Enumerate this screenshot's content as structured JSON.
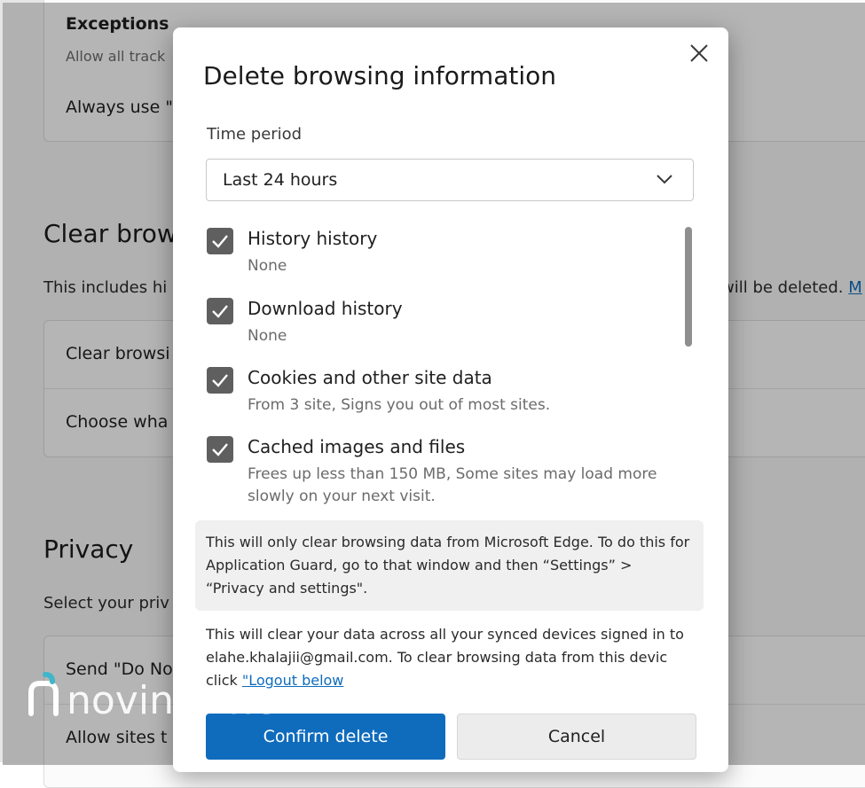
{
  "background": {
    "card1": {
      "exceptions_title": "Exceptions",
      "exceptions_sub": "Allow all track",
      "always_use": "Always use \""
    },
    "clear_section": {
      "title": "Clear brow",
      "desc_left": "This includes hi",
      "desc_right": "will be deleted.",
      "desc_link": "M"
    },
    "card2": {
      "row1": "Clear browsi",
      "row2": "Choose wha"
    },
    "privacy_section": {
      "title": "Privacy",
      "desc": "Select your priv"
    },
    "card3": {
      "row1": "Send \"Do No",
      "row2": "Allow sites t"
    }
  },
  "dialog": {
    "title": "Delete browsing information",
    "time_period_label": "Time period",
    "time_period_value": "Last 24 hours",
    "items": [
      {
        "label": "History history",
        "desc": "None",
        "checked": true
      },
      {
        "label": "Download history",
        "desc": "None",
        "checked": true
      },
      {
        "label": "Cookies and other site data",
        "desc": "From 3 site, Signs you out of most sites.",
        "checked": true
      },
      {
        "label": "Cached images and files",
        "desc": "Frees up less than 150 MB, Some sites may load more slowly on your next visit.",
        "checked": true
      }
    ],
    "note": "This will only clear browsing data from Microsoft Edge. To do this for Application Guard, go to that window and then “Settings” > “Privacy and settings\".",
    "sync_text": "This will clear your data across all your synced devices signed in to elahe.khalajii@gmail.com. To clear browsing data from this devic click",
    "sync_link": "\"Logout below",
    "confirm_label": "Confirm delete",
    "cancel_label": "Cancel"
  },
  "watermark": {
    "brand": "novintether"
  },
  "colors": {
    "accent": "#0f6cbd",
    "checkbox": "#5f5f5f"
  }
}
